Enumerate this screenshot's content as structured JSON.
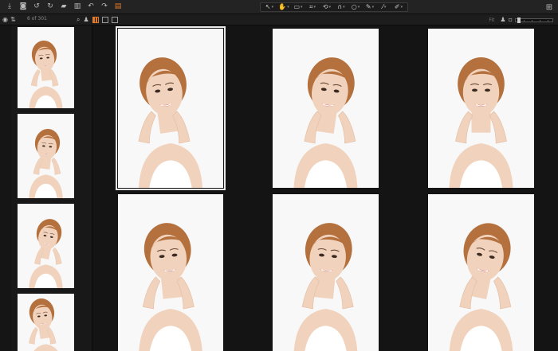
{
  "toolbar": {
    "left_icons": [
      "import-icon",
      "camera-icon",
      "rotate-left-icon",
      "rotate-right-icon",
      "folder-icon",
      "trash-icon",
      "undo-icon",
      "redo-icon",
      "hand-icon"
    ],
    "tools": [
      {
        "name": "select-tool",
        "glyph": "↖",
        "active": false
      },
      {
        "name": "pan-tool",
        "glyph": "✋",
        "active": true
      },
      {
        "name": "loupe-tool",
        "glyph": "▭",
        "active": false
      },
      {
        "name": "crop-tool",
        "glyph": "⌗",
        "active": false
      },
      {
        "name": "rotate-tool",
        "glyph": "⟲",
        "active": false
      },
      {
        "name": "keystone-tool",
        "glyph": "∩",
        "active": false
      },
      {
        "name": "spot-tool",
        "glyph": "○",
        "active": false
      },
      {
        "name": "brush-tool",
        "glyph": "✎",
        "active": false
      },
      {
        "name": "picker-tool",
        "glyph": "⁄",
        "active": false
      },
      {
        "name": "annotate-tool",
        "glyph": "✐",
        "active": false
      }
    ],
    "right_icon": "layout-icon"
  },
  "subbar": {
    "counter": "6 of 301",
    "fit_label": "Fit"
  },
  "colors": {
    "accent": "#e07a2a",
    "background": "#141414",
    "panel": "#232323",
    "hair": "#b4713e",
    "skin": "#f1d3bd"
  },
  "filmstrip": {
    "thumbnails": 4
  },
  "grid": {
    "rows": 2,
    "cols": 3,
    "selected_index": 0
  }
}
